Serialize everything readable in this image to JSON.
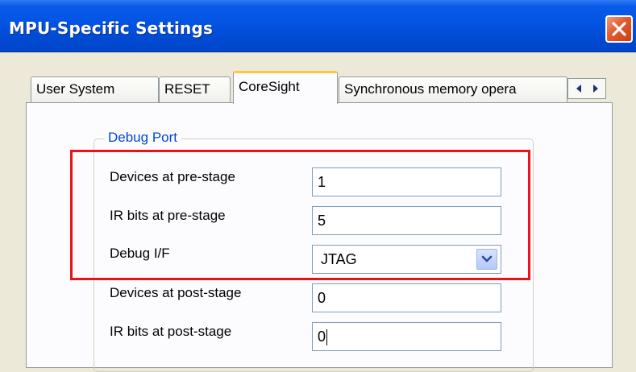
{
  "window": {
    "title": "MPU-Specific Settings",
    "close_icon": "close-icon"
  },
  "tabs": [
    {
      "label": "User System",
      "active": false
    },
    {
      "label": "RESET",
      "active": false
    },
    {
      "label": "CoreSight",
      "active": true
    },
    {
      "label": "Synchronous memory opera",
      "active": false
    }
  ],
  "tab_scroll": {
    "left_icon": "arrow-left-icon",
    "right_icon": "arrow-right-icon"
  },
  "group": {
    "title": "Debug Port",
    "fields": [
      {
        "label": "Devices at pre-stage",
        "value": "1"
      },
      {
        "label": "IR bits at pre-stage",
        "value": "5"
      },
      {
        "label": "Debug I/F",
        "value": "JTAG"
      },
      {
        "label": "Devices at post-stage",
        "value": "0"
      },
      {
        "label": "IR bits at post-stage",
        "value": "0"
      }
    ]
  },
  "colors": {
    "titlebar": "#0353e2",
    "group_title": "#0046d5",
    "highlight": "#e8131b",
    "active_tab_accent": "#ffc83c"
  }
}
